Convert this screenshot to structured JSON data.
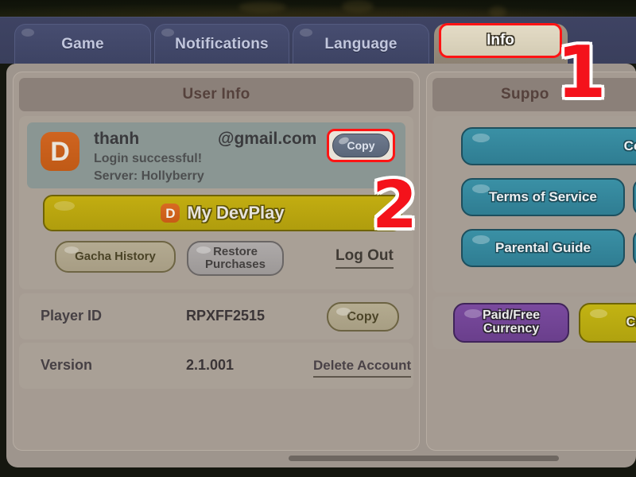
{
  "tabs": [
    {
      "label": "Game",
      "active": false
    },
    {
      "label": "Notifications",
      "active": false
    },
    {
      "label": "Language",
      "active": false
    },
    {
      "label": "Info",
      "active": true
    }
  ],
  "markers": {
    "step1": "1",
    "step2": "2"
  },
  "left_panel": {
    "title": "User Info",
    "account": {
      "avatar_letter": "D",
      "username": "thanh",
      "email_domain": "@gmail.com",
      "status": "Login successful!",
      "server": "Server: Hollyberry",
      "copy_label": "Copy"
    },
    "devplay": {
      "logo_letter": "D",
      "label": "My DevPlay"
    },
    "actions": {
      "gacha_history": "Gacha History",
      "restore_purchases": "Restore\nPurchases",
      "restore_line1": "Restore",
      "restore_line2": "Purchases",
      "log_out": "Log Out"
    },
    "rows": [
      {
        "label": "Player ID",
        "value": "RPXFF2515",
        "action": "Copy"
      },
      {
        "label": "Version",
        "value": "2.1.001",
        "action": "Delete Account"
      }
    ]
  },
  "right_panel": {
    "title": "Suppo",
    "buttons": [
      {
        "label": "Contact S",
        "color": "#2f7d92"
      },
      {
        "label": "Terms of Service",
        "color": "#2f7d92"
      },
      {
        "label": "Parental Guide",
        "color": "#2f7d92"
      }
    ],
    "links": [
      {
        "line1": "Paid/Free",
        "line2": "Currency",
        "color": "#6a3f8c"
      },
      {
        "line1": "Cre",
        "line2": "",
        "color": "#b0a20f"
      }
    ]
  },
  "colors": {
    "accent_red": "#f4121b",
    "tab_active_bg": "#d9d1ba",
    "tab_bar": "#3a3f5c",
    "panel_bg": "#a59b92",
    "sheet_bg": "#9e958d",
    "teal": "#2f7d92",
    "gold": "#b09d0d",
    "purple": "#6a3f8c",
    "avatar_orange": "#c75b16"
  }
}
